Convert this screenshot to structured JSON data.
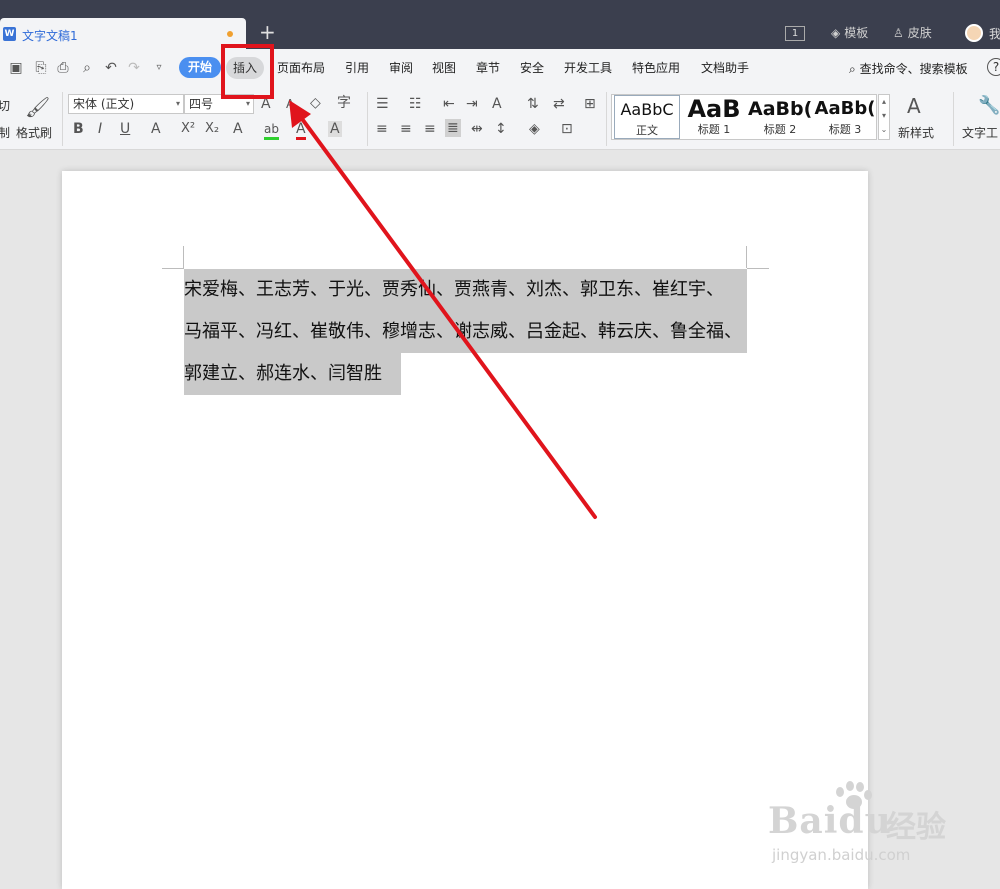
{
  "window": {
    "doc_tab_title": "文字文稿1",
    "add_tab": "+",
    "page_count": "1",
    "template_label": "模板",
    "skin_label": "皮肤",
    "user_label": "我"
  },
  "menu": {
    "items": [
      "开始",
      "插入",
      "页面布局",
      "引用",
      "审阅",
      "视图",
      "章节",
      "安全",
      "开发工具",
      "特色应用",
      "文档助手"
    ],
    "search_label": "查找命令、搜索模板",
    "help": "?"
  },
  "ribbon": {
    "cut_label": "切",
    "copy_label": "制",
    "format_painter_label": "格式刷",
    "font_name": "宋体 (正文)",
    "font_size": "四号",
    "styles": [
      {
        "preview": "AaBbC",
        "name": "正文"
      },
      {
        "preview": "AaB",
        "name": "标题 1"
      },
      {
        "preview": "AaBb(",
        "name": "标题 2"
      },
      {
        "preview": "AaBb(",
        "name": "标题 3"
      }
    ],
    "new_style_label": "新样式",
    "text_tool_label": "文字工"
  },
  "document": {
    "lines": [
      "宋爱梅、王志芳、于光、贾秀仙、贾燕青、刘杰、郭卫东、崔红宇、",
      "马福平、冯红、崔敬伟、穆增志、谢志威、吕金起、韩云庆、鲁全福、",
      "郭建立、郝连水、闫智胜"
    ]
  },
  "watermark": {
    "logo": "Baidu",
    "brand_cn": "经验",
    "url": "jingyan.baidu.com"
  },
  "colors": {
    "accent_blue": "#4a8ff0",
    "annotation_red": "#e0141c",
    "selection_gray": "#c9c9c9"
  }
}
